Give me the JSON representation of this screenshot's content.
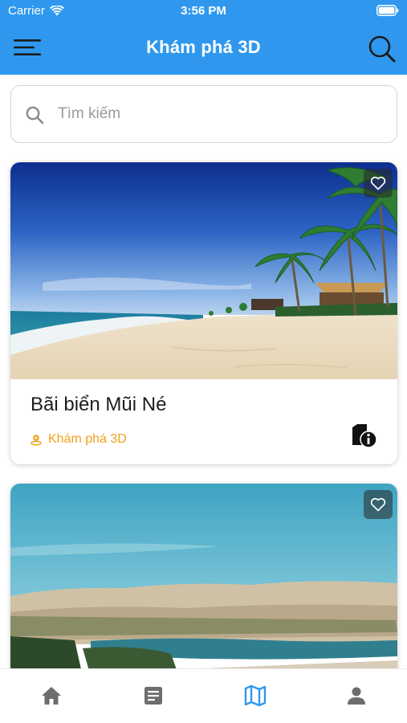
{
  "status": {
    "carrier": "Carrier",
    "time": "3:56 PM"
  },
  "nav": {
    "title": "Khám phá 3D"
  },
  "search": {
    "placeholder": "Tìm kiếm",
    "value": ""
  },
  "cards": [
    {
      "title": "Bãi biển Mũi Né",
      "tag": "Khám phá 3D",
      "favorited": false
    },
    {
      "title": "",
      "tag": "",
      "favorited": false
    }
  ],
  "tabbar": {
    "items": [
      {
        "icon": "home-icon",
        "active": false
      },
      {
        "icon": "article-icon",
        "active": false
      },
      {
        "icon": "map-icon",
        "active": true
      },
      {
        "icon": "person-icon",
        "active": false
      }
    ]
  },
  "colors": {
    "primary": "#2f98ee",
    "accent": "#f0a21a",
    "tab_inactive": "#6d6d6d"
  }
}
